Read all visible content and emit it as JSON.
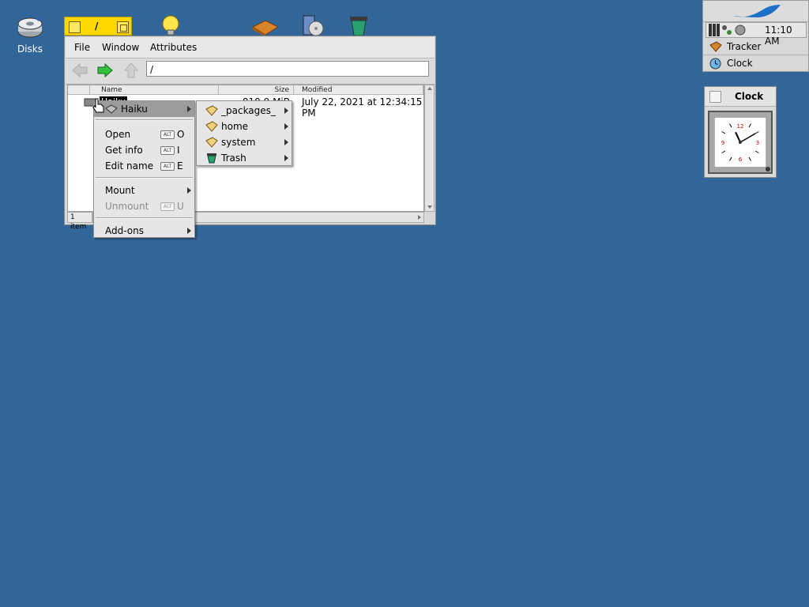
{
  "desktop": {
    "icons": [
      {
        "name": "disks",
        "label": "Disks"
      }
    ]
  },
  "tracker": {
    "tab_title": "/",
    "menubar": [
      "File",
      "Window",
      "Attributes"
    ],
    "path": "/",
    "columns": [
      "Name",
      "Size",
      "Modified"
    ],
    "rows": [
      {
        "name": "Haiku",
        "size": "810.9 MiB",
        "modified": "July 22, 2021 at 12:34:15 PM"
      }
    ],
    "status": "1 item"
  },
  "context_menu": {
    "header": "Haiku",
    "items": [
      {
        "label": "Open",
        "shortcut": "O",
        "alt": "ALT"
      },
      {
        "label": "Get info",
        "shortcut": "I",
        "alt": "ALT"
      },
      {
        "label": "Edit name",
        "shortcut": "E",
        "alt": "ALT"
      },
      {
        "label": "Mount"
      },
      {
        "label": "Unmount",
        "shortcut": "U",
        "alt": "ALT",
        "disabled": true
      },
      {
        "label": "Add-ons"
      }
    ]
  },
  "submenu": {
    "items": [
      "_packages_",
      "home",
      "system",
      "Trash"
    ]
  },
  "deskbar": {
    "time": "11:10 AM",
    "apps": [
      "Tracker",
      "Clock"
    ]
  },
  "clock": {
    "title": "Clock",
    "numerals": [
      "12",
      "3",
      "6",
      "9"
    ],
    "hour": 11,
    "minute": 10
  },
  "colors": {
    "desktop": "#336698",
    "window_tab": "#ffd800",
    "menu": "#e6e6e6",
    "menu_highlight": "#9c9c9c"
  }
}
